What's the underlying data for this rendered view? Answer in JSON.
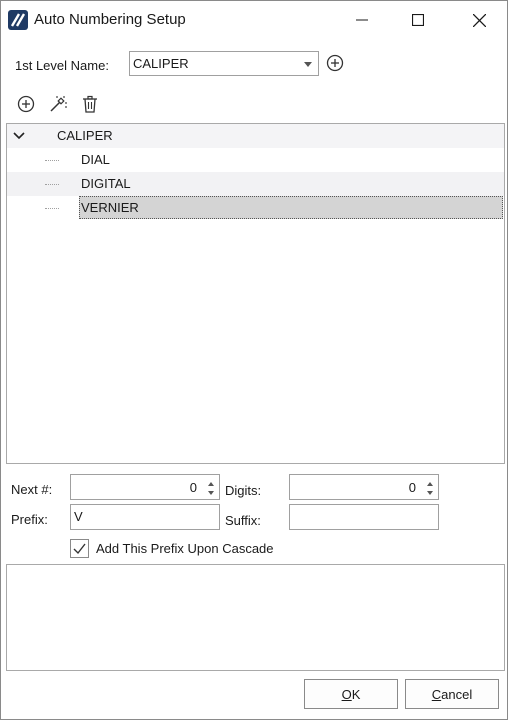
{
  "window": {
    "title": "Auto Numbering Setup",
    "icon": "app-logo-icon"
  },
  "level": {
    "label": "1st Level Name:",
    "selected": "CALIPER"
  },
  "toolbar": {
    "icons": [
      "plus-circle-icon",
      "magic-wand-icon",
      "trash-icon"
    ]
  },
  "tree": {
    "root": "CALIPER",
    "children": [
      "DIAL",
      "DIGITAL",
      "VERNIER"
    ],
    "selected": "VERNIER"
  },
  "fields": {
    "next_label": "Next #:",
    "next_value": "0",
    "digits_label": "Digits:",
    "digits_value": "0",
    "prefix_label": "Prefix:",
    "prefix_value": "V",
    "suffix_label": "Suffix:",
    "suffix_value": ""
  },
  "cascade": {
    "label": "Add This Prefix Upon Cascade",
    "checked": true
  },
  "buttons": {
    "ok_mnemonic": "O",
    "ok_rest": "K",
    "cancel_mnemonic": "C",
    "cancel_rest": "ancel"
  },
  "colors": {
    "accent": "#1f3a64",
    "selection": "#d4d4d4"
  }
}
